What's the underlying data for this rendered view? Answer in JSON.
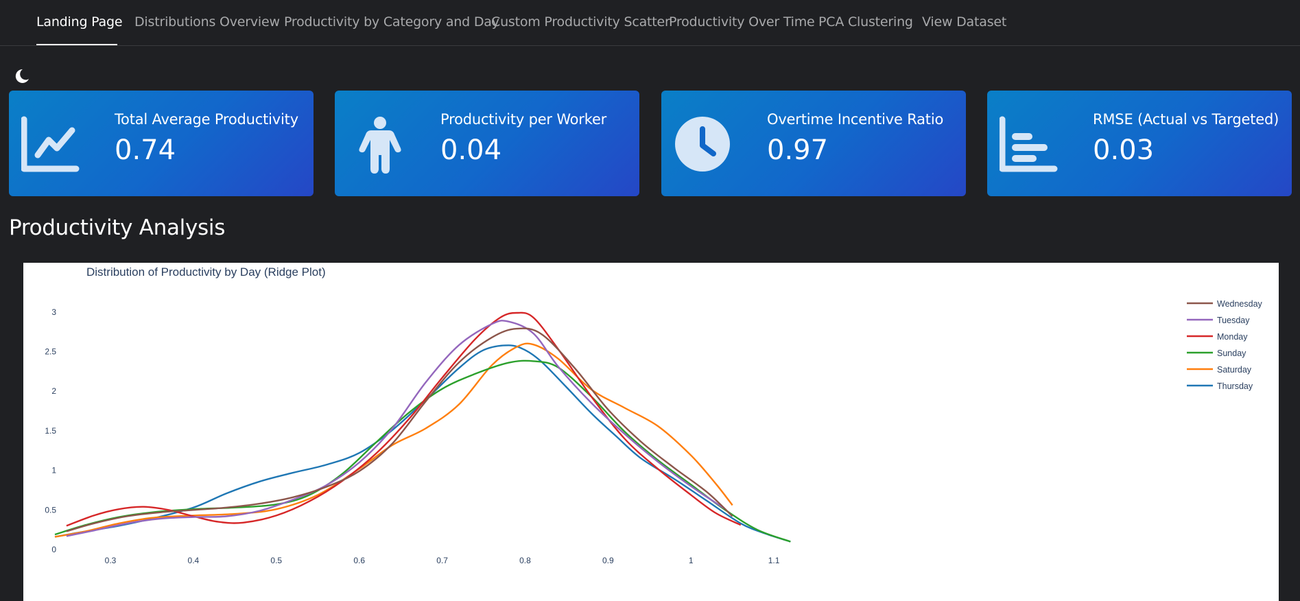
{
  "nav": {
    "tabs": [
      {
        "label": "Landing Page",
        "active": true
      },
      {
        "label": "Distributions Overview",
        "active": false
      },
      {
        "label": "Productivity by Category and Day",
        "active": false
      },
      {
        "label": "Custom Productivity Scatter",
        "active": false
      },
      {
        "label": "Productivity Over Time",
        "active": false
      },
      {
        "label": "PCA Clustering",
        "active": false
      },
      {
        "label": "View Dataset",
        "active": false
      }
    ]
  },
  "theme_toggle": {
    "icon": "moon-icon"
  },
  "kpis": [
    {
      "title": "Total Average Productivity",
      "value": "0.74",
      "icon": "line-chart-icon"
    },
    {
      "title": "Productivity per Worker",
      "value": "0.04",
      "icon": "person-icon"
    },
    {
      "title": "Overtime Incentive Ratio",
      "value": "0.97",
      "icon": "clock-icon"
    },
    {
      "title": "RMSE (Actual vs Targeted)",
      "value": "0.03",
      "icon": "bar-chart-icon"
    }
  ],
  "section": {
    "title": "Productivity Analysis"
  },
  "colors": {
    "card_gradient_start": "#0a7fc7",
    "card_gradient_end": "#2547c6",
    "background": "#1f2023",
    "icon_fill": "#d6e6f7"
  },
  "chart_data": {
    "type": "line",
    "title": "Distribution of Productivity by Day (Ridge Plot)",
    "xlabel": "",
    "ylabel": "",
    "xlim": [
      0.233,
      1.133
    ],
    "ylim": [
      0,
      3.12
    ],
    "xticks": [
      "0.3",
      "0.4",
      "0.5",
      "0.6",
      "0.7",
      "0.8",
      "0.9",
      "1",
      "1.1"
    ],
    "yticks": [
      "0",
      "0.5",
      "1",
      "1.5",
      "2",
      "2.5",
      "3"
    ],
    "grid": false,
    "legend_position": "top-right",
    "series": [
      {
        "name": "Wednesday",
        "color": "#8c564b",
        "x": [
          0.247,
          0.28,
          0.32,
          0.36,
          0.4,
          0.44,
          0.48,
          0.52,
          0.56,
          0.6,
          0.64,
          0.68,
          0.72,
          0.76,
          0.79,
          0.82,
          0.86,
          0.9,
          0.94,
          0.98,
          1.02,
          1.05
        ],
        "y": [
          0.23,
          0.33,
          0.42,
          0.47,
          0.5,
          0.53,
          0.58,
          0.66,
          0.79,
          0.99,
          1.34,
          1.87,
          2.36,
          2.68,
          2.79,
          2.72,
          2.29,
          1.77,
          1.36,
          1.03,
          0.72,
          0.42
        ]
      },
      {
        "name": "Tuesday",
        "color": "#9467bd",
        "x": [
          0.247,
          0.28,
          0.32,
          0.36,
          0.4,
          0.44,
          0.48,
          0.52,
          0.56,
          0.6,
          0.64,
          0.68,
          0.72,
          0.76,
          0.78,
          0.81,
          0.84,
          0.88,
          0.92,
          0.96,
          1.0,
          1.04
        ],
        "y": [
          0.17,
          0.24,
          0.33,
          0.39,
          0.41,
          0.42,
          0.49,
          0.63,
          0.81,
          1.1,
          1.53,
          2.11,
          2.58,
          2.85,
          2.88,
          2.73,
          2.31,
          1.85,
          1.46,
          1.11,
          0.8,
          0.52
        ]
      },
      {
        "name": "Monday",
        "color": "#d62728",
        "x": [
          0.247,
          0.28,
          0.31,
          0.34,
          0.37,
          0.4,
          0.43,
          0.46,
          0.5,
          0.54,
          0.58,
          0.62,
          0.66,
          0.7,
          0.74,
          0.77,
          0.79,
          0.81,
          0.84,
          0.88,
          0.92,
          0.96,
          1.0,
          1.03,
          1.06
        ],
        "y": [
          0.3,
          0.43,
          0.51,
          0.54,
          0.5,
          0.42,
          0.35,
          0.34,
          0.43,
          0.61,
          0.87,
          1.21,
          1.65,
          2.17,
          2.66,
          2.93,
          2.99,
          2.93,
          2.53,
          1.93,
          1.4,
          1.02,
          0.69,
          0.46,
          0.31
        ]
      },
      {
        "name": "Sunday",
        "color": "#2ca02c",
        "x": [
          0.233,
          0.27,
          0.31,
          0.35,
          0.4,
          0.45,
          0.5,
          0.54,
          0.58,
          0.62,
          0.66,
          0.7,
          0.74,
          0.78,
          0.81,
          0.84,
          0.88,
          0.92,
          0.96,
          1.0,
          1.04,
          1.08,
          1.12
        ],
        "y": [
          0.19,
          0.31,
          0.41,
          0.47,
          0.51,
          0.53,
          0.57,
          0.69,
          0.96,
          1.35,
          1.73,
          2.03,
          2.22,
          2.36,
          2.38,
          2.3,
          1.93,
          1.49,
          1.13,
          0.82,
          0.51,
          0.25,
          0.1
        ]
      },
      {
        "name": "Saturday",
        "color": "#ff7f0e",
        "x": [
          0.233,
          0.27,
          0.31,
          0.35,
          0.4,
          0.45,
          0.5,
          0.55,
          0.6,
          0.64,
          0.68,
          0.72,
          0.76,
          0.79,
          0.81,
          0.84,
          0.88,
          0.92,
          0.96,
          1.0,
          1.03,
          1.05
        ],
        "y": [
          0.16,
          0.23,
          0.33,
          0.4,
          0.43,
          0.45,
          0.51,
          0.69,
          1.02,
          1.32,
          1.53,
          1.83,
          2.33,
          2.56,
          2.59,
          2.41,
          2.02,
          1.79,
          1.56,
          1.19,
          0.83,
          0.56
        ]
      },
      {
        "name": "Thursday",
        "color": "#1f77b4",
        "x": [
          0.233,
          0.27,
          0.31,
          0.35,
          0.4,
          0.44,
          0.48,
          0.52,
          0.56,
          0.6,
          0.64,
          0.68,
          0.72,
          0.75,
          0.78,
          0.8,
          0.82,
          0.85,
          0.88,
          0.91,
          0.94,
          0.98,
          1.02,
          1.06,
          1.09,
          1.12
        ],
        "y": [
          0.16,
          0.23,
          0.3,
          0.39,
          0.53,
          0.71,
          0.86,
          0.97,
          1.07,
          1.22,
          1.51,
          1.89,
          2.29,
          2.52,
          2.58,
          2.52,
          2.37,
          2.05,
          1.72,
          1.43,
          1.15,
          0.89,
          0.61,
          0.33,
          0.2,
          0.1
        ]
      }
    ]
  }
}
